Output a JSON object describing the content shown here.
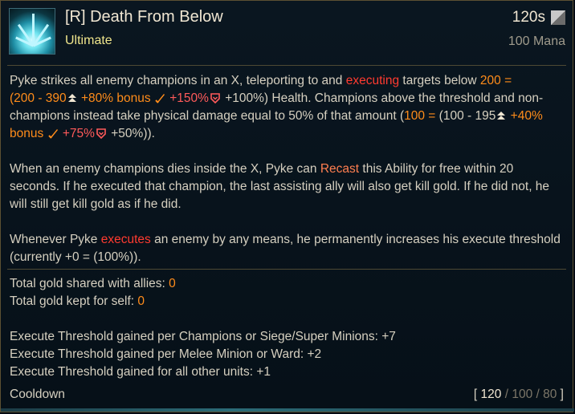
{
  "ability": {
    "title": "[R] Death From Below",
    "subtitle": "Ultimate",
    "cooldown_header": "120s",
    "cost": "100 Mana"
  },
  "description": {
    "p1": {
      "a": "Pyke strikes all enemy champions in an X, teleporting to and ",
      "executing": "executing",
      "b": " targets below ",
      "dmg_value": "200 =",
      "c": "(200 - 390",
      "bonus80": " +80% bonus ",
      "hp150": " +150%",
      "d": " +100%) Health. Champions above the threshold and non-champions instead take physical damage equal to 50% of that amount (",
      "dmg2": "100 =",
      "e": " (100 - 195",
      "bonus40": " +40% bonus ",
      "hp75": " +75%",
      "f": " +50%",
      "g": "))."
    },
    "p2": {
      "a": "When an enemy champions dies inside the X, Pyke can ",
      "recast": "Recast",
      "b": " this Ability for free within 20 seconds. If he executed that champion, the last assisting ally will also get kill gold. If he did not, he will still get kill gold as if he did."
    },
    "p3": {
      "a": "Whenever Pyke ",
      "executes": "executes",
      "b": " an enemy by any means, he permanently increases his execute threshold (currently +0 = (100%))."
    }
  },
  "stats": {
    "shared_label": "Total gold shared with allies: ",
    "shared_value": "0",
    "kept_label": "Total gold kept for self: ",
    "kept_value": "0",
    "threshold_champs": "Execute Threshold gained per Champions or Siege/Super Minions: +7",
    "threshold_melee": "Execute Threshold gained per Melee Minion or Ward: +2",
    "threshold_other": "Execute Threshold gained for all other units: +1"
  },
  "cooldown": {
    "label": "Cooldown",
    "open": "[ ",
    "rank1": "120",
    "sep1": " / ",
    "rank2": "100",
    "sep2": " / ",
    "rank3": "80",
    "close": " ]"
  },
  "colors": {
    "execute_red": "#ff3b30",
    "recast": "#ff7f50",
    "scaling_orange": "#ff8c1a",
    "health_pink": "#ff5a5a",
    "subtitle_yellow": "#f0e68c"
  }
}
